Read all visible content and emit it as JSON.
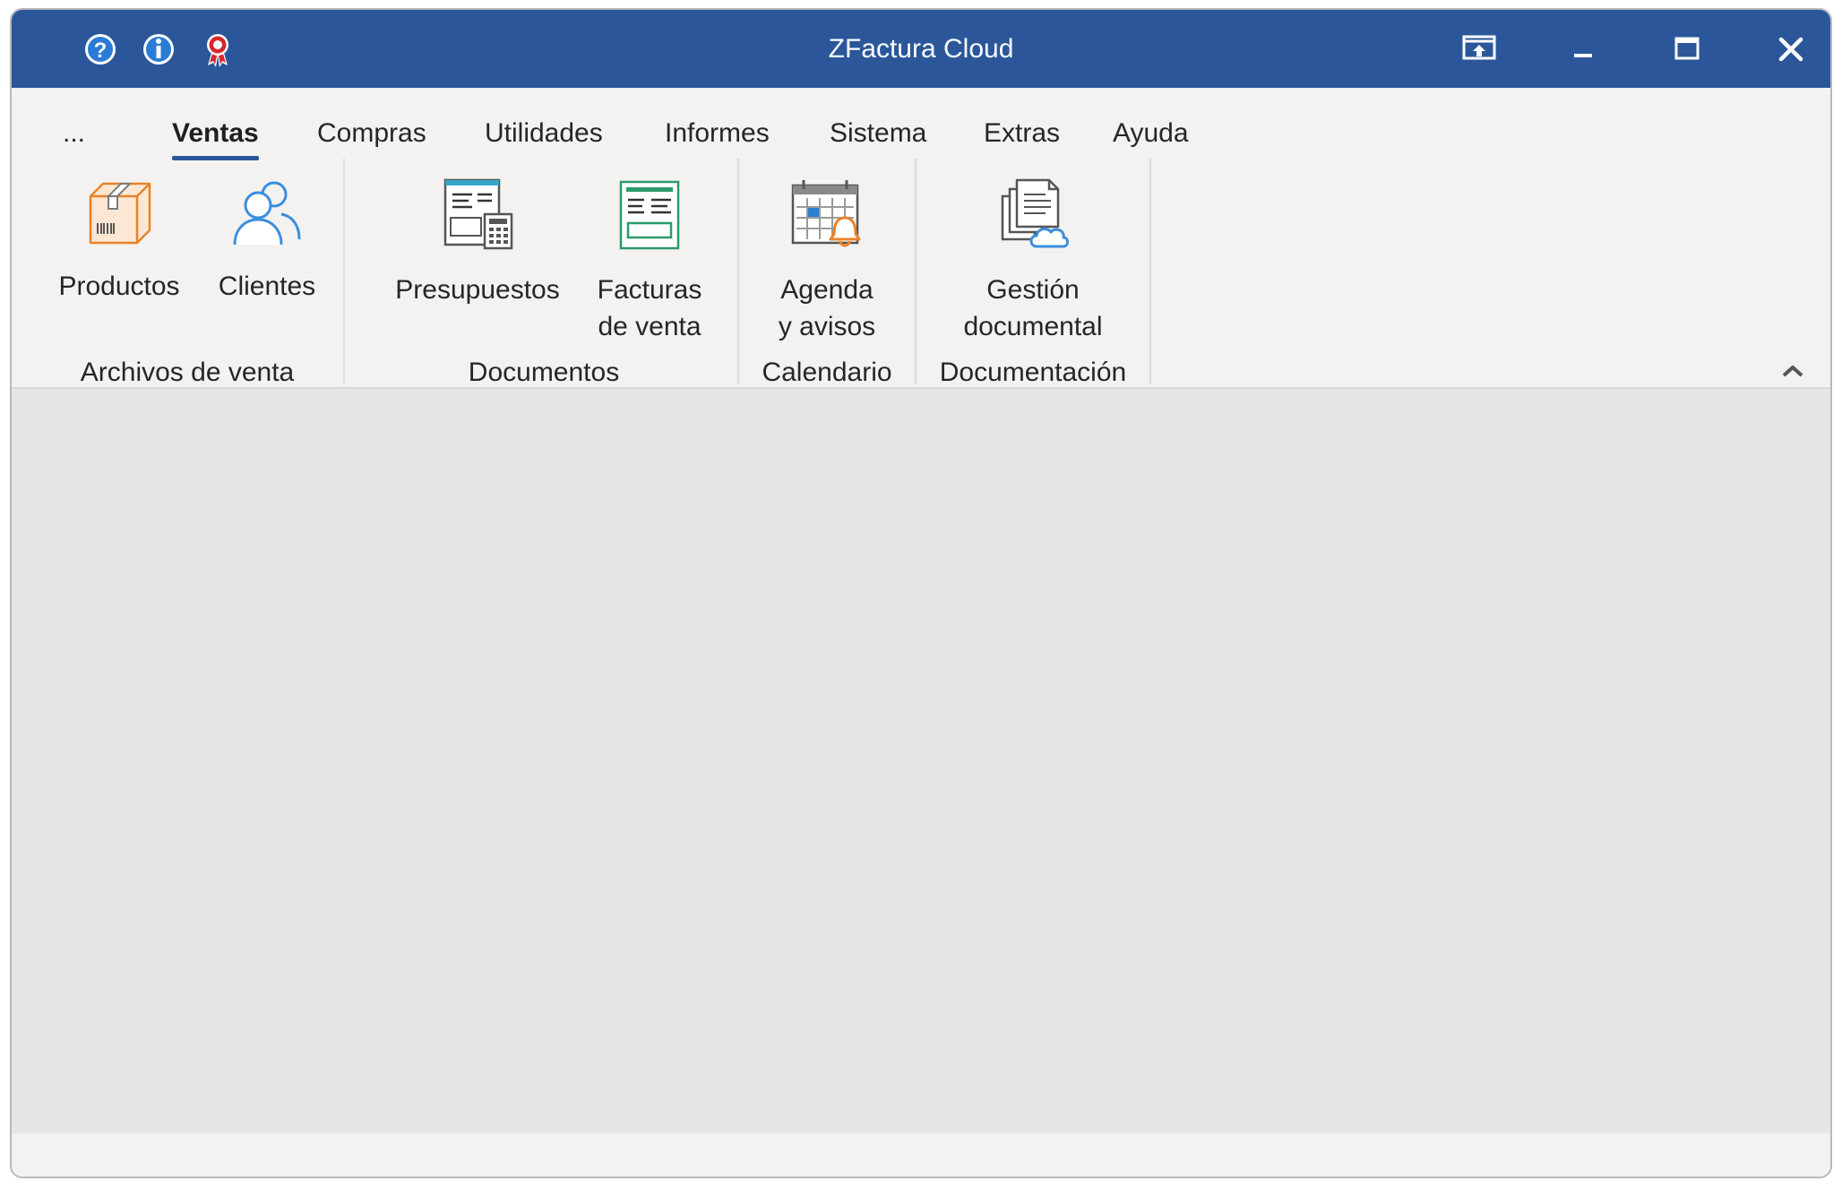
{
  "window": {
    "title": "ZFactura Cloud",
    "titlebar_color": "#2b579a",
    "quick_icons": [
      "help-icon",
      "info-icon",
      "award-icon"
    ],
    "controls": [
      "restore-to-tray-icon",
      "minimize-icon",
      "maximize-icon",
      "close-icon"
    ]
  },
  "tabs": [
    {
      "label": "..."
    },
    {
      "label": "Ventas",
      "active": true
    },
    {
      "label": "Compras"
    },
    {
      "label": "Utilidades"
    },
    {
      "label": "Informes"
    },
    {
      "label": "Sistema"
    },
    {
      "label": "Extras"
    },
    {
      "label": "Ayuda"
    }
  ],
  "ribbon": {
    "groups": [
      {
        "label": "Archivos de venta",
        "commands": [
          {
            "label": "Productos",
            "icon": "package-icon"
          },
          {
            "label": "Clientes",
            "icon": "users-icon"
          }
        ]
      },
      {
        "label": "Documentos",
        "commands": [
          {
            "label": "Presupuestos",
            "icon": "quote-calculator-icon"
          },
          {
            "label": "Facturas\nde venta",
            "icon": "invoice-icon"
          }
        ]
      },
      {
        "label": "Calendario",
        "commands": [
          {
            "label": "Agenda\ny avisos",
            "icon": "calendar-bell-icon"
          }
        ]
      },
      {
        "label": "Documentación",
        "commands": [
          {
            "label": "Gestión\ndocumental",
            "icon": "cloud-documents-icon"
          }
        ]
      }
    ],
    "collapse_icon": "chevron-up-icon"
  }
}
